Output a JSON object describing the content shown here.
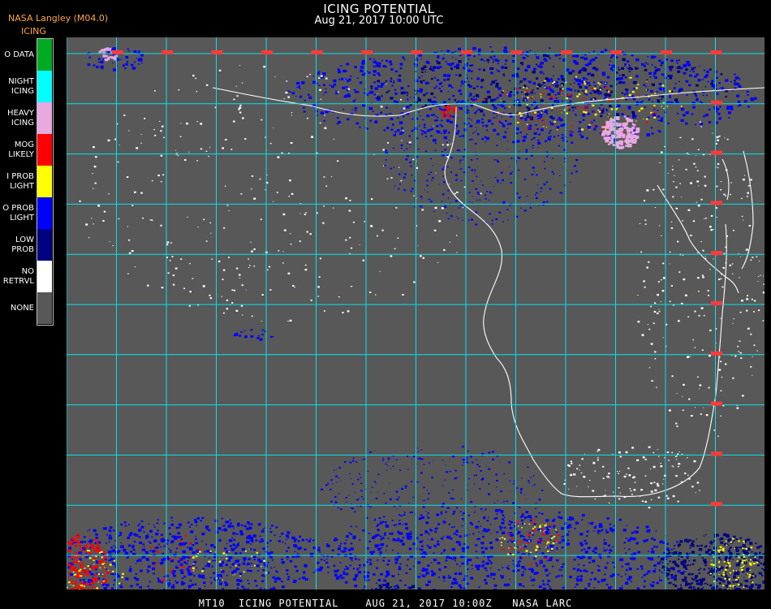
{
  "header": {
    "title": "ICING POTENTIAL",
    "subtitle": "Aug 21, 2017 10:00 UTC",
    "provider": "NASA Langley (M04.0)"
  },
  "legend": {
    "heading": "ICING",
    "items": [
      {
        "label": "O DATA",
        "color": "#00aa22"
      },
      {
        "label": "NIGHT\nICING",
        "color": "#00ffff"
      },
      {
        "label": "HEAVY\nICING",
        "color": "#e8a8e0"
      },
      {
        "label": "MOG\nLIKELY",
        "color": "#ff0000"
      },
      {
        "label": "I PROB\nLIGHT",
        "color": "#ffff00"
      },
      {
        "label": "O PROB\nLIGHT",
        "color": "#0000ff"
      },
      {
        "label": "LOW\nPROB",
        "color": "#000080"
      },
      {
        "label": "NO\nRETRVL",
        "color": "#ffffff"
      },
      {
        "label": "NONE",
        "color": "#585858"
      }
    ]
  },
  "map": {
    "background": "#585858",
    "grid_color": "#00e5ee",
    "coast_color": "#ffffff",
    "label_color": "#ff3a3a"
  },
  "footer": {
    "text": "MT10  ICING POTENTIAL    AUG 21, 2017 10:00Z   NASA LARC"
  }
}
